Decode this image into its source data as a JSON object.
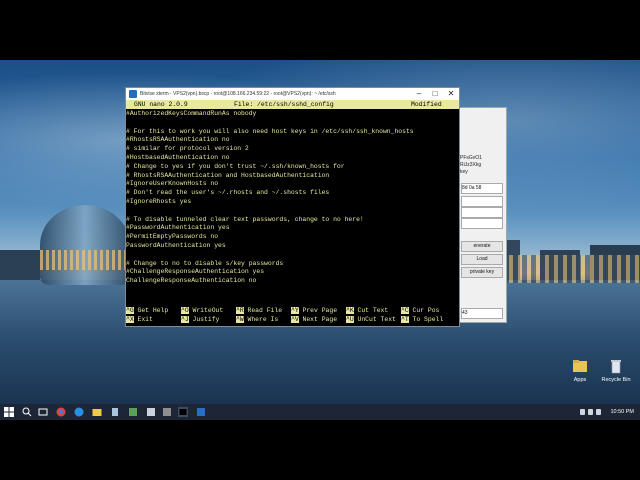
{
  "terminal": {
    "title": "Bitvise xterm - VPS2(vpn).bscp - root@108.166.234.59:22 - root@VPS2(vpn): ~ /etc/ssh",
    "nano_version": "GNU nano 2.0.9",
    "file_label": "File: /etc/ssh/sshd_config",
    "status": "Modified",
    "lines": [
      "#AuthorizedKeysCommandRunAs nobody",
      "",
      "# For this to work you will also need host keys in /etc/ssh/ssh_known_hosts",
      "#RhostsRSAAuthentication no",
      "# similar for protocol version 2",
      "#HostbasedAuthentication no",
      "# Change to yes if you don't trust ~/.ssh/known_hosts for",
      "# RhostsRSAAuthentication and HostbasedAuthentication",
      "#IgnoreUserKnownHosts no",
      "# Don't read the user's ~/.rhosts and ~/.shosts files",
      "#IgnoreRhosts yes",
      "",
      "# To disable tunneled clear text passwords, change to no here!",
      "#PasswordAuthentication yes",
      "#PermitEmptyPasswords no",
      "PasswordAuthentication yes",
      "",
      "# Change to no to disable s/key passwords",
      "#ChallengeResponseAuthentication yes",
      "ChallengeResponseAuthentication no"
    ],
    "help_row1": [
      {
        "key": "^G",
        "label": "Get Help"
      },
      {
        "key": "^O",
        "label": "WriteOut"
      },
      {
        "key": "^R",
        "label": "Read File"
      },
      {
        "key": "^Y",
        "label": "Prev Page"
      },
      {
        "key": "^K",
        "label": "Cut Text"
      },
      {
        "key": "^C",
        "label": "Cur Pos"
      }
    ],
    "help_row2": [
      {
        "key": "^X",
        "label": "Exit"
      },
      {
        "key": "^J",
        "label": "Justify"
      },
      {
        "key": "^W",
        "label": "Where Is"
      },
      {
        "key": "^V",
        "label": "Next Page"
      },
      {
        "key": "^U",
        "label": "UnCut Text"
      },
      {
        "key": "^T",
        "label": "To Spell"
      }
    ]
  },
  "bg_window": {
    "text1": "PFsGvO1",
    "text2": "RiJz3Xkg",
    "text3": "key",
    "field1": "8d 0a 58",
    "btn_generate": "enerate",
    "btn_load": "Load",
    "btn_private": "private key",
    "field_bottom": "43"
  },
  "desktop_icons": [
    {
      "label": "Apps"
    },
    {
      "label": "Recycle Bin"
    }
  ],
  "taskbar": {
    "time": "10:50 PM"
  },
  "colors": {
    "nano_fg": "#e8e8a0",
    "taskbar": "#1c2636"
  }
}
